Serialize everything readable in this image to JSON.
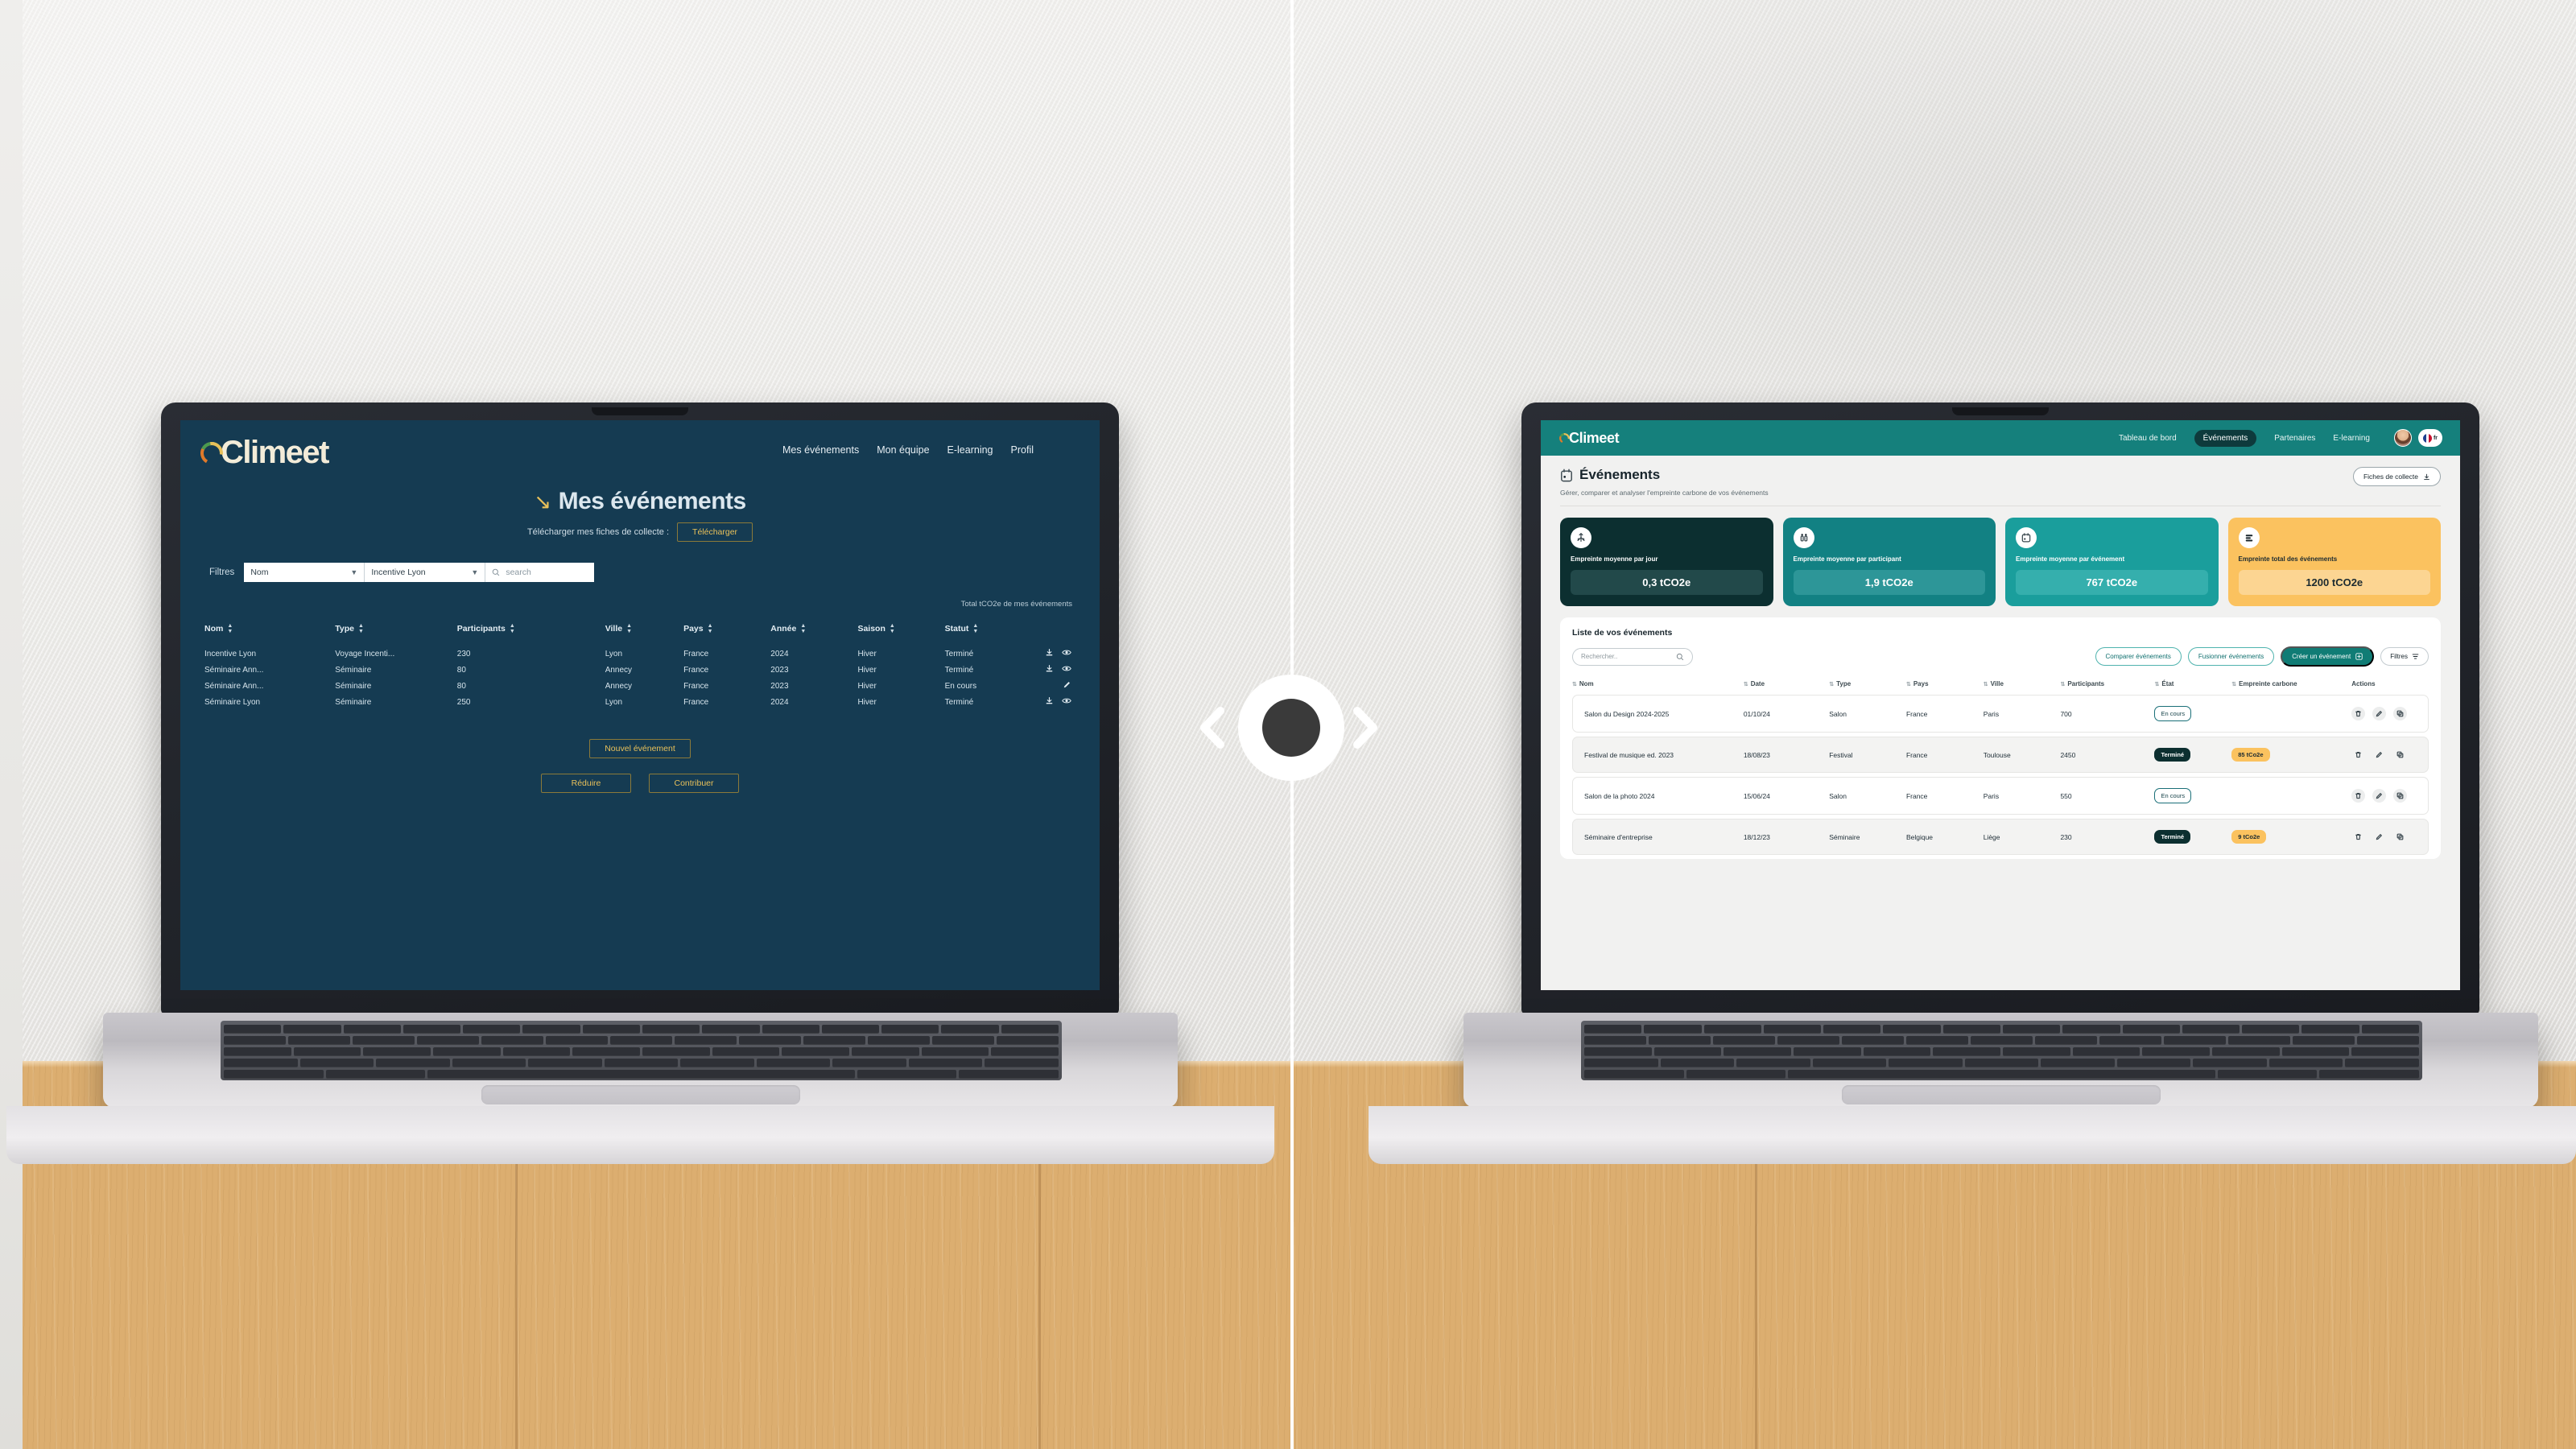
{
  "brand": {
    "name": "Climeet",
    "accent_teal": "#15807c",
    "accent_dark": "#0c2f30",
    "accent_gold": "#fbc25f",
    "old_navy": "#153b52"
  },
  "comparison": {
    "handle_label": "before-after-slider"
  },
  "old_ui": {
    "logo": "Climeet",
    "nav": [
      {
        "label": "Mes événements"
      },
      {
        "label": "Mon équipe"
      },
      {
        "label": "E-learning"
      },
      {
        "label": "Profil"
      }
    ],
    "title": "Mes événements",
    "title_arrow": "↘",
    "download_label": "Télécharger mes fiches de collecte :",
    "download_button": "Télécharger",
    "filters_label": "Filtres",
    "filter_field": "Nom",
    "filter_value": "Incentive Lyon",
    "search_placeholder": "search",
    "total_label": "Total tCO2e de mes événements",
    "columns": [
      "Nom",
      "Type",
      "Participants",
      "Ville",
      "Pays",
      "Année",
      "Saison",
      "Statut"
    ],
    "rows": [
      {
        "nom": "Incentive Lyon",
        "type": "Voyage Incenti...",
        "participants": "230",
        "ville": "Lyon",
        "pays": "France",
        "annee": "2024",
        "saison": "Hiver",
        "statut": "Terminé",
        "actions": [
          "download-icon",
          "eye-icon"
        ]
      },
      {
        "nom": "Séminaire Ann...",
        "type": "Séminaire",
        "participants": "80",
        "ville": "Annecy",
        "pays": "France",
        "annee": "2023",
        "saison": "Hiver",
        "statut": "Terminé",
        "actions": [
          "download-icon",
          "eye-icon"
        ]
      },
      {
        "nom": "Séminaire Ann...",
        "type": "Séminaire",
        "participants": "80",
        "ville": "Annecy",
        "pays": "France",
        "annee": "2023",
        "saison": "Hiver",
        "statut": "En cours",
        "actions": [
          "pencil-icon"
        ]
      },
      {
        "nom": "Séminaire Lyon",
        "type": "Séminaire",
        "participants": "250",
        "ville": "Lyon",
        "pays": "France",
        "annee": "2024",
        "saison": "Hiver",
        "statut": "Terminé",
        "actions": [
          "download-icon",
          "eye-icon"
        ]
      }
    ],
    "new_event_button": "Nouvel événement",
    "reduce_button": "Réduire",
    "contribute_button": "Contribuer"
  },
  "new_ui": {
    "logo": "Climeet",
    "nav": [
      {
        "label": "Tableau de bord",
        "active": false
      },
      {
        "label": "Événements",
        "active": true
      },
      {
        "label": "Partenaires",
        "active": false
      },
      {
        "label": "E-learning",
        "active": false
      }
    ],
    "locale_badge": "fr",
    "page_title": "Événements",
    "page_subtitle": "Gérer, comparer et analyser l'empreinte carbone de vos événements",
    "collect_button": "Fiches de collecte",
    "kpis": [
      {
        "label": "Empreinte moyenne par jour",
        "value": "0,3 tCO2e",
        "icon": "footprint-icon"
      },
      {
        "label": "Empreinte moyenne par participant",
        "value": "1,9 tCO2e",
        "icon": "people-icon"
      },
      {
        "label": "Empreinte moyenne par événement",
        "value": "767 tCO2e",
        "icon": "calendar-icon"
      },
      {
        "label": "Empreinte total des événements",
        "value": "1200 tCO2e",
        "icon": "bars-icon"
      }
    ],
    "panel_title": "Liste de vos événements",
    "search_placeholder": "Rechercher..",
    "buttons": {
      "compare": "Comparer événements",
      "merge": "Fusionner événements",
      "create": "Créer un événement",
      "filters": "Filtres"
    },
    "columns": [
      "Nom",
      "Date",
      "Type",
      "Pays",
      "Ville",
      "Participants",
      "État",
      "Empreinte carbone",
      "Actions"
    ],
    "rows": [
      {
        "nom": "Salon du Design 2024-2025",
        "date": "01/10/24",
        "type": "Salon",
        "pays": "France",
        "ville": "Paris",
        "participants": "700",
        "etat": "En cours",
        "etat_kind": "encours",
        "empreinte": "",
        "actions": [
          "trash-icon",
          "pencil-icon",
          "copy-icon"
        ]
      },
      {
        "nom": "Festival de musique ed. 2023",
        "date": "18/08/23",
        "type": "Festival",
        "pays": "France",
        "ville": "Toulouse",
        "participants": "2450",
        "etat": "Terminé",
        "etat_kind": "termine",
        "empreinte": "85 tCo2e",
        "actions": [
          "trash-icon",
          "pencil-icon",
          "copy-icon"
        ]
      },
      {
        "nom": "Salon de la photo 2024",
        "date": "15/06/24",
        "type": "Salon",
        "pays": "France",
        "ville": "Paris",
        "participants": "550",
        "etat": "En cours",
        "etat_kind": "encours",
        "empreinte": "",
        "actions": [
          "trash-icon",
          "pencil-icon",
          "copy-icon"
        ]
      },
      {
        "nom": "Séminaire d'entreprise",
        "date": "18/12/23",
        "type": "Séminaire",
        "pays": "Belgique",
        "ville": "Liège",
        "participants": "230",
        "etat": "Terminé",
        "etat_kind": "termine",
        "empreinte": "9 tCo2e",
        "actions": [
          "trash-icon",
          "pencil-icon",
          "copy-icon"
        ]
      }
    ]
  }
}
